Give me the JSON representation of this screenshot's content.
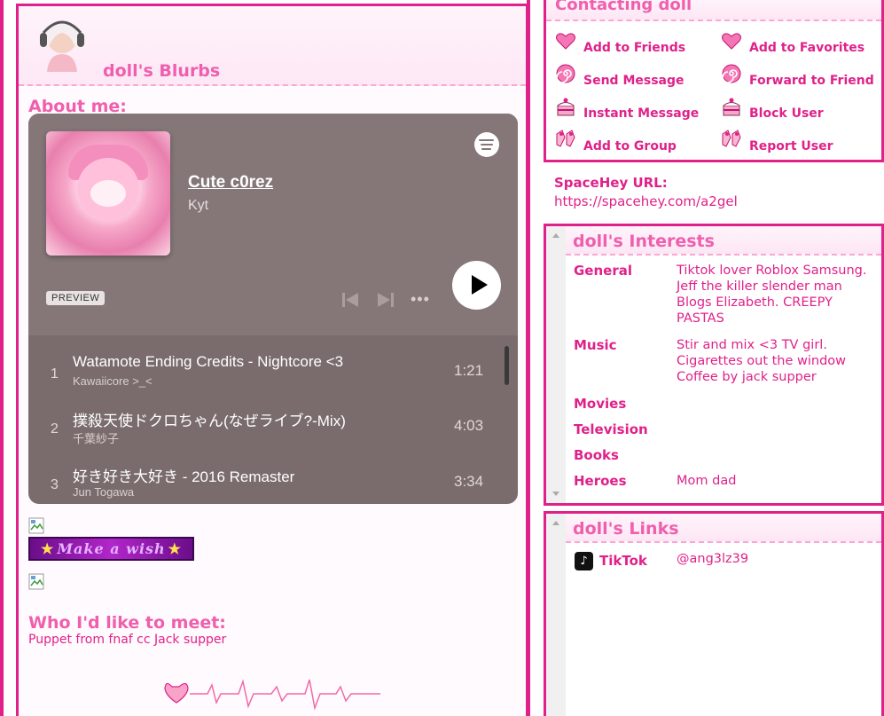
{
  "blurbs": {
    "title": "doll's Blurbs"
  },
  "about": {
    "heading": "About me:"
  },
  "spotify": {
    "playlist_title": "Cute c0rez",
    "artist": "Kyt",
    "preview_label": "PREVIEW",
    "more": "•••",
    "tracks": [
      {
        "num": "1",
        "name": "Watamote Ending Credits - Nightcore <3",
        "artist": "Kawaiicore >_<",
        "duration": "1:21"
      },
      {
        "num": "2",
        "name": "撲殺天使ドクロちゃん(なぜライブ?-Mix)",
        "artist": "千葉紗子",
        "duration": "4:03"
      },
      {
        "num": "3",
        "name": "好き好き大好き - 2016 Remaster",
        "artist": "Jun Togawa",
        "duration": "3:34"
      }
    ]
  },
  "banner": {
    "text": "Make a wish",
    "star": "★"
  },
  "meet": {
    "heading": "Who I'd like to meet:",
    "text": "Puppet from fnaf cc Jack supper"
  },
  "contact": {
    "title": "Contacting doll",
    "actions": [
      {
        "label": "Add to Friends",
        "icon": "heart-icon"
      },
      {
        "label": "Add to Favorites",
        "icon": "heart-icon"
      },
      {
        "label": "Send Message",
        "icon": "swirl-candy-icon"
      },
      {
        "label": "Forward to Friend",
        "icon": "swirl-candy-icon"
      },
      {
        "label": "Instant Message",
        "icon": "cake-icon"
      },
      {
        "label": "Block User",
        "icon": "cake-icon"
      },
      {
        "label": "Add to Group",
        "icon": "ribbon-shoes-icon"
      },
      {
        "label": "Report User",
        "icon": "ribbon-shoes-icon"
      }
    ]
  },
  "url": {
    "label": "SpaceHey URL:",
    "value": "https://spacehey.com/a2gel"
  },
  "interests": {
    "title": "doll's Interests",
    "rows": [
      {
        "label": "General",
        "value": "Tiktok lover Roblox Samsung. Jeff the killer slender man Blogs Elizabeth. CREEPY PASTAS"
      },
      {
        "label": "Music",
        "value": "Stir and mix <3 TV girl. Cigarettes out the window Coffee by jack supper"
      },
      {
        "label": "Movies",
        "value": ""
      },
      {
        "label": "Television",
        "value": ""
      },
      {
        "label": "Books",
        "value": ""
      },
      {
        "label": "Heroes",
        "value": "Mom dad"
      }
    ]
  },
  "links": {
    "title": "doll's Links",
    "items": [
      {
        "label": "TikTok",
        "value": "@ang3lz39",
        "icon": "tiktok-icon",
        "icon_glyph": "♪"
      }
    ]
  }
}
